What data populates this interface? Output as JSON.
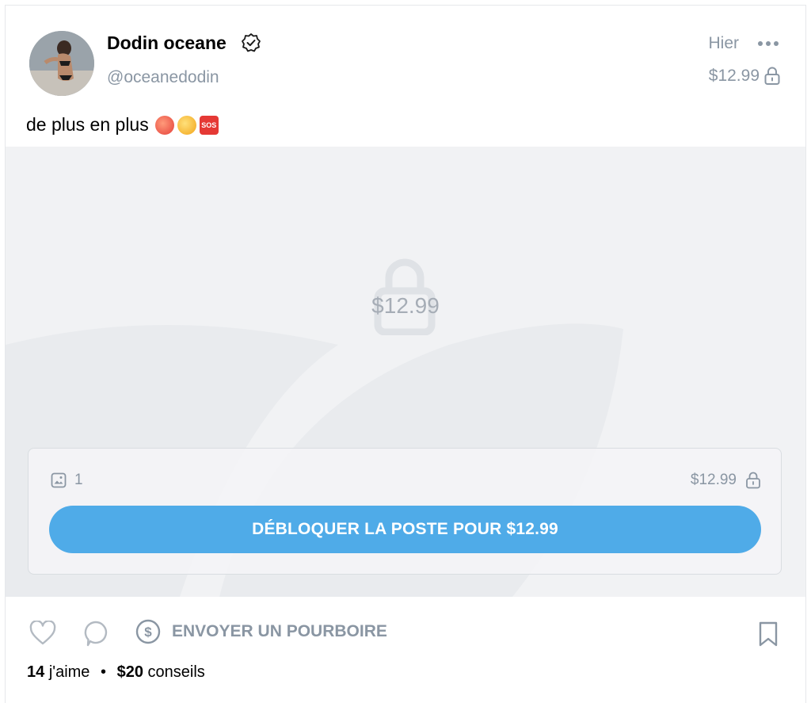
{
  "post": {
    "author_name": "Dodin oceane",
    "author_handle": "@oceanedodin",
    "date": "Hier",
    "price": "$12.99",
    "caption": "de plus en plus",
    "caption_emoji": [
      "hot-face",
      "hand-over-mouth",
      "sos"
    ],
    "sos_text": "SOS"
  },
  "media": {
    "locked_price": "$12.99",
    "image_count": "1",
    "box_price": "$12.99",
    "unlock_button": "DÉBLOQUER LA POSTE POUR $12.99"
  },
  "actions": {
    "tip_label": "ENVOYER UN POURBOIRE"
  },
  "stats": {
    "likes_count": "14",
    "likes_label": "j'aime",
    "tips_amount": "$20",
    "tips_label": "conseils"
  },
  "colors": {
    "accent": "#4fabe8",
    "muted_text": "#8a96a3",
    "media_bg": "#f1f2f4"
  }
}
